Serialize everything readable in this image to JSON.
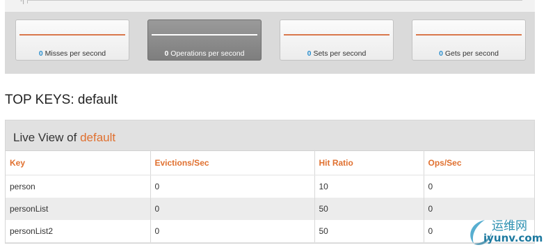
{
  "graph": {
    "axis_label": "-|"
  },
  "stats": [
    {
      "value": "0",
      "label": "Misses per second",
      "selected": false
    },
    {
      "value": "0",
      "label": "Operations per second",
      "selected": true
    },
    {
      "value": "0",
      "label": "Sets per second",
      "selected": false
    },
    {
      "value": "0",
      "label": "Gets per second",
      "selected": false
    }
  ],
  "heading": "TOP KEYS: default",
  "live_view": {
    "prefix": "Live View of ",
    "bucket": "default",
    "columns": [
      "Key",
      "Evictions/Sec",
      "Hit Ratio",
      "Ops/Sec"
    ],
    "rows": [
      [
        "person",
        "0",
        "10",
        "0"
      ],
      [
        "personList",
        "0",
        "50",
        "0"
      ],
      [
        "personList2",
        "0",
        "50",
        "0"
      ]
    ]
  },
  "watermark": {
    "cn": "运维网",
    "en": "iyunv.com"
  },
  "colors": {
    "accent_orange": "#e0702f",
    "value_blue": "#2b8fce",
    "band_gray": "#dadada"
  }
}
